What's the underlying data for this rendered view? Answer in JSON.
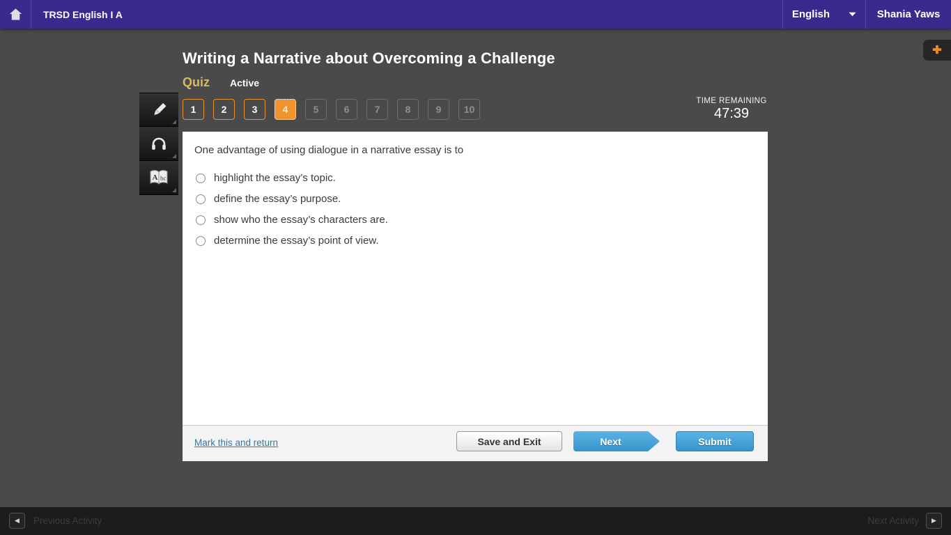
{
  "header": {
    "course_title": "TRSD English I A",
    "language": "English",
    "user_name": "Shania Yaws",
    "icons": [
      "home-icon",
      "chevron-down-icon"
    ]
  },
  "lesson": {
    "title": "Writing a Narrative about Overcoming a Challenge",
    "type_label": "Quiz",
    "status_label": "Active"
  },
  "timer": {
    "label": "TIME REMAINING",
    "value": "47:39"
  },
  "question_nav": {
    "items": [
      {
        "n": "1",
        "state": "answered"
      },
      {
        "n": "2",
        "state": "answered"
      },
      {
        "n": "3",
        "state": "answered"
      },
      {
        "n": "4",
        "state": "current"
      },
      {
        "n": "5",
        "state": "locked"
      },
      {
        "n": "6",
        "state": "locked"
      },
      {
        "n": "7",
        "state": "locked"
      },
      {
        "n": "8",
        "state": "locked"
      },
      {
        "n": "9",
        "state": "locked"
      },
      {
        "n": "10",
        "state": "locked"
      }
    ]
  },
  "tools": {
    "items": [
      {
        "icon": "highlighter-icon"
      },
      {
        "icon": "headphones-icon"
      },
      {
        "icon": "glossary-icon"
      }
    ]
  },
  "add_tab": {
    "icon": "plus-icon"
  },
  "question": {
    "prompt": "One advantage of using dialogue in a narrative essay is to",
    "options": [
      "highlight the essay’s topic.",
      "define the essay’s purpose.",
      "show who the essay’s characters are.",
      "determine the essay’s point of view."
    ],
    "selected_index": -1
  },
  "card_footer": {
    "mark_link": "Mark this and return",
    "save_exit_label": "Save and Exit",
    "next_label": "Next",
    "submit_label": "Submit"
  },
  "bottom_nav": {
    "previous_label": "Previous Activity",
    "next_label": "Next Activity",
    "icons": [
      "previous-arrow-icon",
      "next-arrow-icon"
    ]
  },
  "colors": {
    "brand_purple": "#392a8e",
    "accent_orange": "#f0922e",
    "action_blue": "#3f9fd6",
    "link_blue": "#35799f",
    "quiz_gold": "#d6ba60",
    "page_background": "#4a4a4a"
  }
}
